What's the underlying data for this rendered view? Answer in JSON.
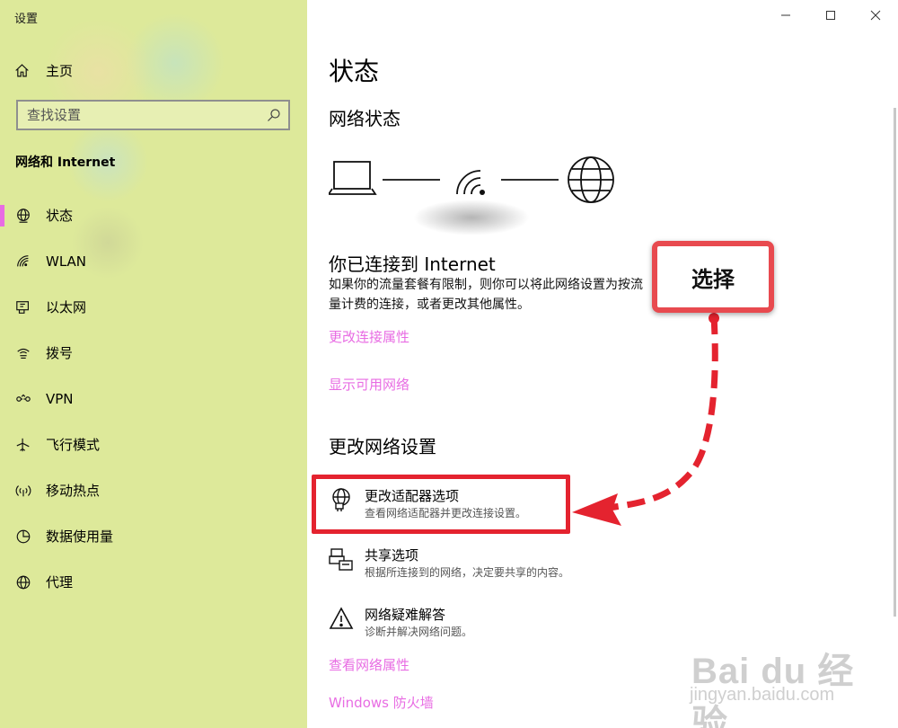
{
  "window": {
    "title": "设置",
    "controls": [
      "minimize",
      "maximize",
      "close"
    ]
  },
  "sidebar": {
    "home_label": "主页",
    "search_placeholder": "查找设置",
    "section_title": "网络和 Internet",
    "items": [
      {
        "label": "状态",
        "icon": "globe-network-icon",
        "active": true
      },
      {
        "label": "WLAN",
        "icon": "wifi-icon",
        "active": false
      },
      {
        "label": "以太网",
        "icon": "ethernet-icon",
        "active": false
      },
      {
        "label": "拨号",
        "icon": "dialup-icon",
        "active": false
      },
      {
        "label": "VPN",
        "icon": "vpn-icon",
        "active": false
      },
      {
        "label": "飞行模式",
        "icon": "airplane-icon",
        "active": false
      },
      {
        "label": "移动热点",
        "icon": "hotspot-icon",
        "active": false
      },
      {
        "label": "数据使用量",
        "icon": "data-usage-icon",
        "active": false
      },
      {
        "label": "代理",
        "icon": "globe-icon",
        "active": false
      }
    ]
  },
  "main": {
    "title": "状态",
    "network_status_heading": "网络状态",
    "connected_title": "你已连接到 Internet",
    "connected_desc": "如果你的流量套餐有限制，则你可以将此网络设置为按流量计费的连接，或者更改其他属性。",
    "links": {
      "change_connection_properties": "更改连接属性",
      "show_available_networks": "显示可用网络",
      "view_network_properties": "查看网络属性",
      "windows_firewall": "Windows 防火墙"
    },
    "change_settings_heading": "更改网络设置",
    "options": [
      {
        "title": "更改适配器选项",
        "subtitle": "查看网络适配器并更改连接设置。",
        "icon": "adapter-icon"
      },
      {
        "title": "共享选项",
        "subtitle": "根据所连接到的网络，决定要共享的内容。",
        "icon": "sharing-icon"
      },
      {
        "title": "网络疑难解答",
        "subtitle": "诊断并解决网络问题。",
        "icon": "warning-icon"
      }
    ]
  },
  "annotation": {
    "callout_text": "选择",
    "highlight_color": "#e4232f",
    "callout_border_color": "#e84a4f"
  },
  "watermark": {
    "main": "Bai du 经验",
    "sub": "jingyan.baidu.com"
  },
  "colors": {
    "sidebar_bg": "#dde99a",
    "accent": "#e86ce3"
  }
}
